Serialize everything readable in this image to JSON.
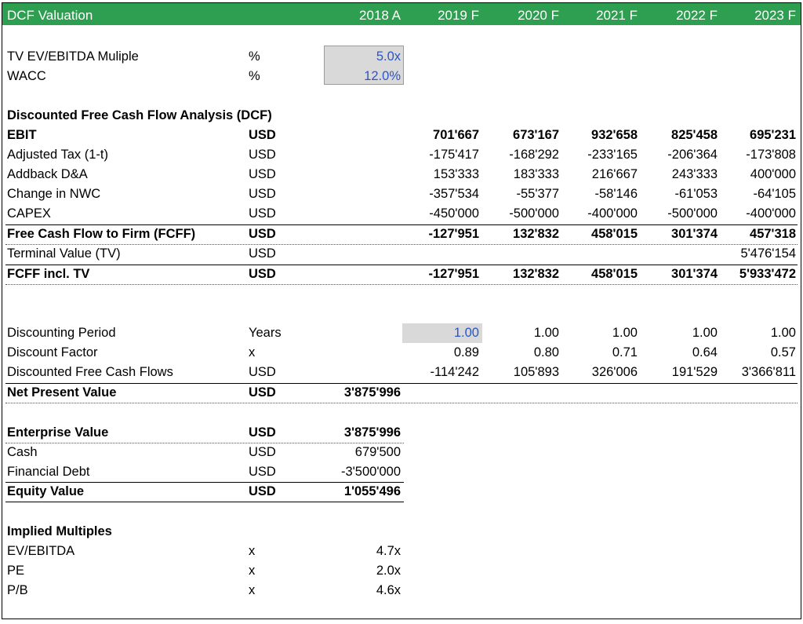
{
  "header": {
    "title": "DCF Valuation",
    "years": [
      "2018 A",
      "2019 F",
      "2020 F",
      "2021 F",
      "2022 F",
      "2023 F"
    ]
  },
  "assumptions": [
    {
      "label": "TV EV/EBITDA Muliple",
      "unit": "%",
      "value": "5.0x"
    },
    {
      "label": "WACC",
      "unit": "%",
      "value": "12.0%"
    }
  ],
  "dcf": {
    "section_title": "Discounted Free Cash Flow Analysis (DCF)",
    "rows": [
      {
        "label": "EBIT",
        "unit": "USD",
        "values": [
          "701'667",
          "673'167",
          "932'658",
          "825'458",
          "695'231"
        ]
      },
      {
        "label": "Adjusted Tax (1-t)",
        "unit": "USD",
        "values": [
          "-175'417",
          "-168'292",
          "-233'165",
          "-206'364",
          "-173'808"
        ]
      },
      {
        "label": "Addback D&A",
        "unit": "USD",
        "values": [
          "153'333",
          "183'333",
          "216'667",
          "243'333",
          "400'000"
        ]
      },
      {
        "label": "Change in NWC",
        "unit": "USD",
        "values": [
          "-357'534",
          "-55'377",
          "-58'146",
          "-61'053",
          "-64'105"
        ]
      },
      {
        "label": "CAPEX",
        "unit": "USD",
        "values": [
          "-450'000",
          "-500'000",
          "-400'000",
          "-500'000",
          "-400'000"
        ]
      },
      {
        "label": "Free Cash Flow to Firm (FCFF)",
        "unit": "USD",
        "values": [
          "-127'951",
          "132'832",
          "458'015",
          "301'374",
          "457'318"
        ]
      },
      {
        "label": "Terminal Value (TV)",
        "unit": "USD",
        "values": [
          "",
          "",
          "",
          "",
          "5'476'154"
        ]
      },
      {
        "label": "FCFF incl. TV",
        "unit": "USD",
        "values": [
          "-127'951",
          "132'832",
          "458'015",
          "301'374",
          "5'933'472"
        ]
      }
    ]
  },
  "discounting": {
    "rows": [
      {
        "label": "Discounting Period",
        "unit": "Years",
        "values": [
          "1.00",
          "1.00",
          "1.00",
          "1.00",
          "1.00"
        ]
      },
      {
        "label": "Discount Factor",
        "unit": "x",
        "values": [
          "0.89",
          "0.80",
          "0.71",
          "0.64",
          "0.57"
        ]
      },
      {
        "label": "Discounted Free Cash Flows",
        "unit": "USD",
        "values": [
          "-114'242",
          "105'893",
          "326'006",
          "191'529",
          "3'366'811"
        ]
      }
    ],
    "npv": {
      "label": "Net Present Value",
      "unit": "USD",
      "value": "3'875'996"
    }
  },
  "equity_bridge": [
    {
      "label": "Enterprise Value",
      "unit": "USD",
      "value": "3'875'996"
    },
    {
      "label": "Cash",
      "unit": "USD",
      "value": "679'500"
    },
    {
      "label": "Financial Debt",
      "unit": "USD",
      "value": "-3'500'000"
    },
    {
      "label": "Equity Value",
      "unit": "USD",
      "value": "1'055'496"
    }
  ],
  "multiples": {
    "section_title": "Implied Multiples",
    "rows": [
      {
        "label": "EV/EBITDA",
        "unit": "x",
        "value": "4.7x"
      },
      {
        "label": "PE",
        "unit": "x",
        "value": "2.0x"
      },
      {
        "label": "P/B",
        "unit": "x",
        "value": "4.6x"
      }
    ]
  },
  "colors": {
    "header_bg": "#2e9e50",
    "input_blue": "#2b54c8",
    "input_fill": "#d9d9d9"
  }
}
